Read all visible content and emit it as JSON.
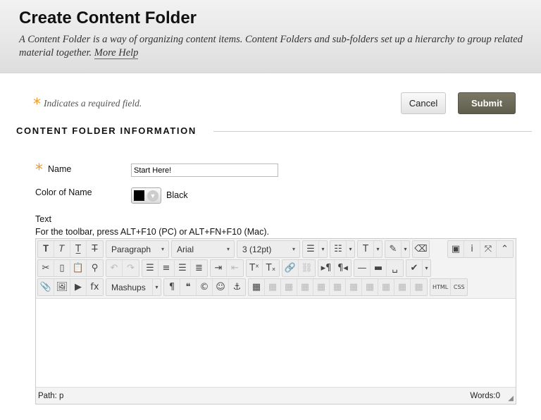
{
  "header": {
    "title": "Create Content Folder",
    "description": "A Content Folder is a way of organizing content items. Content Folders and sub-folders set up a hierarchy to group related material together. ",
    "more_help": "More Help"
  },
  "required_note": {
    "star": "*",
    "text": "Indicates a required field."
  },
  "actions": {
    "cancel": "Cancel",
    "submit": "Submit"
  },
  "section": {
    "title": "CONTENT FOLDER INFORMATION"
  },
  "form": {
    "name_label": "Name",
    "name_value": "Start Here!",
    "color_label": "Color of Name",
    "color_value": "Black",
    "color_hex": "#000000",
    "text_label": "Text",
    "toolbar_hint": "For the toolbar, press ALT+F10 (PC) or ALT+FN+F10 (Mac)."
  },
  "editor": {
    "selects": {
      "paragraph": "Paragraph",
      "font": "Arial",
      "size": "3 (12pt)",
      "mashups": "Mashups"
    },
    "rows": [
      [
        [
          "bold",
          "italic",
          "underline",
          "strikethrough"
        ],
        [
          "sel:paragraph"
        ],
        [
          "sel:font"
        ],
        [
          "sel:size"
        ],
        [
          "bullet-list",
          "dd"
        ],
        [
          "numbered-list",
          "dd"
        ],
        [
          "text-color",
          "dd"
        ],
        [
          "highlight",
          "dd"
        ],
        [
          "eraser"
        ],
        [
          "spacer"
        ],
        [
          "preview",
          "info",
          "fullscreen",
          "collapse-toolbar"
        ]
      ],
      [
        [
          "cut",
          "copy",
          "paste",
          "find"
        ],
        [
          "undo:dis",
          "redo:dis"
        ],
        [
          "align-left",
          "align-center",
          "align-right",
          "justify"
        ],
        [
          "indent",
          "outdent:dis"
        ],
        [
          "superscript",
          "subscript"
        ],
        [
          "link:dis",
          "unlink:dis"
        ],
        [
          "ltr",
          "rtl"
        ],
        [
          "horizontal-rule",
          "thick-rule",
          "nbsp"
        ],
        [
          "spellcheck",
          "dd"
        ]
      ],
      [
        [
          "attach",
          "image",
          "media",
          "formula"
        ],
        [
          "sel:mashups",
          "dd"
        ],
        [
          "pilcrow",
          "quote",
          "copyright",
          "emoticon",
          "anchor"
        ],
        [
          "table",
          "t:dis",
          "t:dis",
          "t:dis",
          "t:dis",
          "t:dis",
          "t:dis",
          "t:dis",
          "t:dis",
          "t:dis",
          "t:dis"
        ],
        [
          "html",
          "css"
        ]
      ]
    ],
    "path_label": "Path: p",
    "words_label": "Words:0"
  },
  "colors": {
    "accent_star": "#f29a2e",
    "submit_bg": "#6b6957"
  }
}
